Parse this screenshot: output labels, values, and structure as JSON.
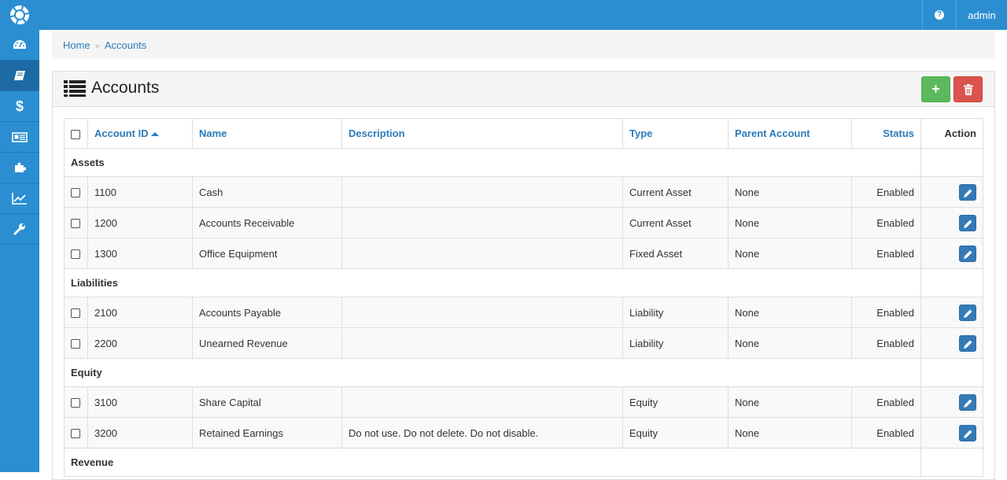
{
  "topbar": {
    "user": "admin"
  },
  "breadcrumb": {
    "home": "Home",
    "current": "Accounts"
  },
  "panel": {
    "title": "Accounts"
  },
  "table": {
    "headers": {
      "account_id": "Account ID",
      "name": "Name",
      "description": "Description",
      "type": "Type",
      "parent": "Parent Account",
      "status": "Status",
      "action": "Action"
    },
    "groups": [
      {
        "label": "Assets",
        "rows": [
          {
            "id": "1100",
            "name": "Cash",
            "description": "",
            "type": "Current Asset",
            "parent": "None",
            "status": "Enabled"
          },
          {
            "id": "1200",
            "name": "Accounts Receivable",
            "description": "",
            "type": "Current Asset",
            "parent": "None",
            "status": "Enabled"
          },
          {
            "id": "1300",
            "name": "Office Equipment",
            "description": "",
            "type": "Fixed Asset",
            "parent": "None",
            "status": "Enabled"
          }
        ]
      },
      {
        "label": "Liabilities",
        "rows": [
          {
            "id": "2100",
            "name": "Accounts Payable",
            "description": "",
            "type": "Liability",
            "parent": "None",
            "status": "Enabled"
          },
          {
            "id": "2200",
            "name": "Unearned Revenue",
            "description": "",
            "type": "Liability",
            "parent": "None",
            "status": "Enabled"
          }
        ]
      },
      {
        "label": "Equity",
        "rows": [
          {
            "id": "3100",
            "name": "Share Capital",
            "description": "",
            "type": "Equity",
            "parent": "None",
            "status": "Enabled"
          },
          {
            "id": "3200",
            "name": "Retained Earnings",
            "description": "Do not use. Do not delete. Do not disable.",
            "type": "Equity",
            "parent": "None",
            "status": "Enabled"
          }
        ]
      },
      {
        "label": "Revenue",
        "rows": []
      }
    ]
  },
  "sidebar": {
    "items": [
      {
        "icon": "dashboard-icon"
      },
      {
        "icon": "book-icon",
        "active": true
      },
      {
        "icon": "dollar-icon"
      },
      {
        "icon": "newspaper-icon"
      },
      {
        "icon": "puzzle-icon"
      },
      {
        "icon": "chart-line-icon"
      },
      {
        "icon": "wrench-icon"
      }
    ]
  },
  "colors": {
    "primary": "#2b8ed1",
    "add": "#5cb85c",
    "delete": "#d9534f",
    "edit": "#337ab7"
  }
}
